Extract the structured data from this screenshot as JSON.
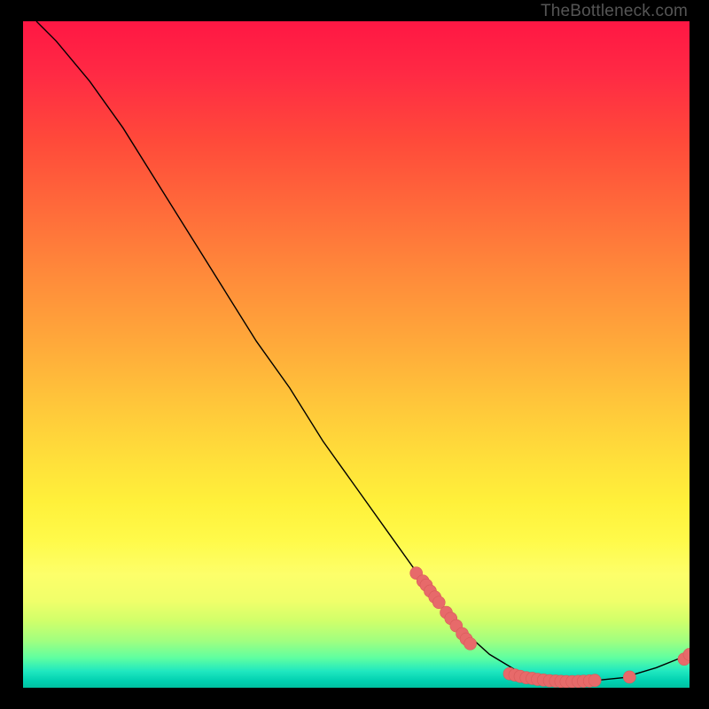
{
  "attribution": "TheBottleneck.com",
  "chart_data": {
    "type": "line",
    "title": "",
    "xlabel": "",
    "ylabel": "",
    "xlim": [
      0,
      100
    ],
    "ylim": [
      0,
      100
    ],
    "curve": [
      {
        "x": 2,
        "y": 100
      },
      {
        "x": 5,
        "y": 97
      },
      {
        "x": 10,
        "y": 91
      },
      {
        "x": 15,
        "y": 84
      },
      {
        "x": 20,
        "y": 76
      },
      {
        "x": 25,
        "y": 68
      },
      {
        "x": 30,
        "y": 60
      },
      {
        "x": 35,
        "y": 52
      },
      {
        "x": 40,
        "y": 45
      },
      {
        "x": 45,
        "y": 37
      },
      {
        "x": 50,
        "y": 30
      },
      {
        "x": 55,
        "y": 23
      },
      {
        "x": 60,
        "y": 16
      },
      {
        "x": 65,
        "y": 9.5
      },
      {
        "x": 70,
        "y": 5
      },
      {
        "x": 75,
        "y": 2
      },
      {
        "x": 80,
        "y": 1
      },
      {
        "x": 85,
        "y": 1
      },
      {
        "x": 90,
        "y": 1.5
      },
      {
        "x": 95,
        "y": 3
      },
      {
        "x": 100,
        "y": 5
      }
    ],
    "scatter": [
      {
        "x": 59,
        "y": 17.2
      },
      {
        "x": 60,
        "y": 16.0
      },
      {
        "x": 60.5,
        "y": 15.4
      },
      {
        "x": 61.1,
        "y": 14.5
      },
      {
        "x": 61.8,
        "y": 13.6
      },
      {
        "x": 62.4,
        "y": 12.8
      },
      {
        "x": 63.5,
        "y": 11.3
      },
      {
        "x": 64.2,
        "y": 10.4
      },
      {
        "x": 65.0,
        "y": 9.3
      },
      {
        "x": 65.9,
        "y": 8.1
      },
      {
        "x": 66.5,
        "y": 7.3
      },
      {
        "x": 67.1,
        "y": 6.6
      },
      {
        "x": 73.0,
        "y": 2.1
      },
      {
        "x": 73.8,
        "y": 1.9
      },
      {
        "x": 74.6,
        "y": 1.7
      },
      {
        "x": 75.5,
        "y": 1.5
      },
      {
        "x": 76.4,
        "y": 1.4
      },
      {
        "x": 77.2,
        "y": 1.25
      },
      {
        "x": 78.1,
        "y": 1.15
      },
      {
        "x": 79.0,
        "y": 1.05
      },
      {
        "x": 79.9,
        "y": 1.0
      },
      {
        "x": 80.7,
        "y": 0.95
      },
      {
        "x": 81.5,
        "y": 0.92
      },
      {
        "x": 82.4,
        "y": 0.92
      },
      {
        "x": 83.3,
        "y": 0.95
      },
      {
        "x": 84.1,
        "y": 0.98
      },
      {
        "x": 85.0,
        "y": 1.02
      },
      {
        "x": 85.8,
        "y": 1.1
      },
      {
        "x": 91.0,
        "y": 1.6
      },
      {
        "x": 99.2,
        "y": 4.3
      },
      {
        "x": 100,
        "y": 5.0
      }
    ],
    "colors": {
      "curve_stroke": "#000000",
      "marker_fill": "#e76a6a",
      "marker_stroke": "#d85a5a"
    }
  }
}
